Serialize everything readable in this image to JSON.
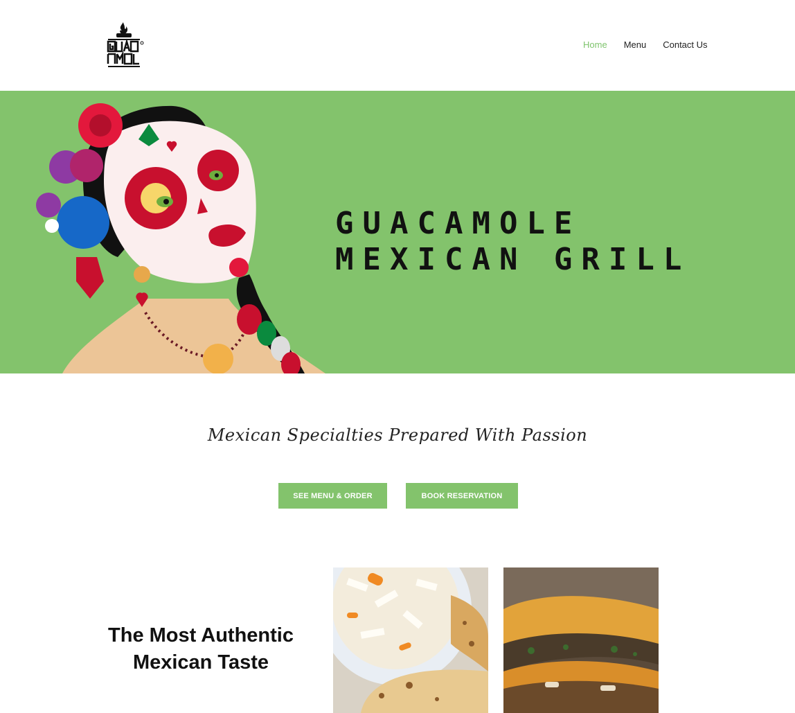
{
  "header": {
    "logo_alt": "Guacamole Mexican Grill",
    "nav": {
      "home": "Home",
      "menu": "Menu",
      "contact": "Contact Us"
    }
  },
  "hero": {
    "title_line1": "GUACAMOLE",
    "title_line2": "MEXICAN GRILL"
  },
  "tagline": "Mexican Specialties Prepared With Passion",
  "buttons": {
    "menu_order": "SEE MENU & ORDER",
    "reservation": "BOOK RESERVATION"
  },
  "feature": {
    "title": "The Most Authentic Mexican Taste"
  },
  "colors": {
    "accent_green": "#83c36c",
    "nav_active": "#7fc46d"
  }
}
